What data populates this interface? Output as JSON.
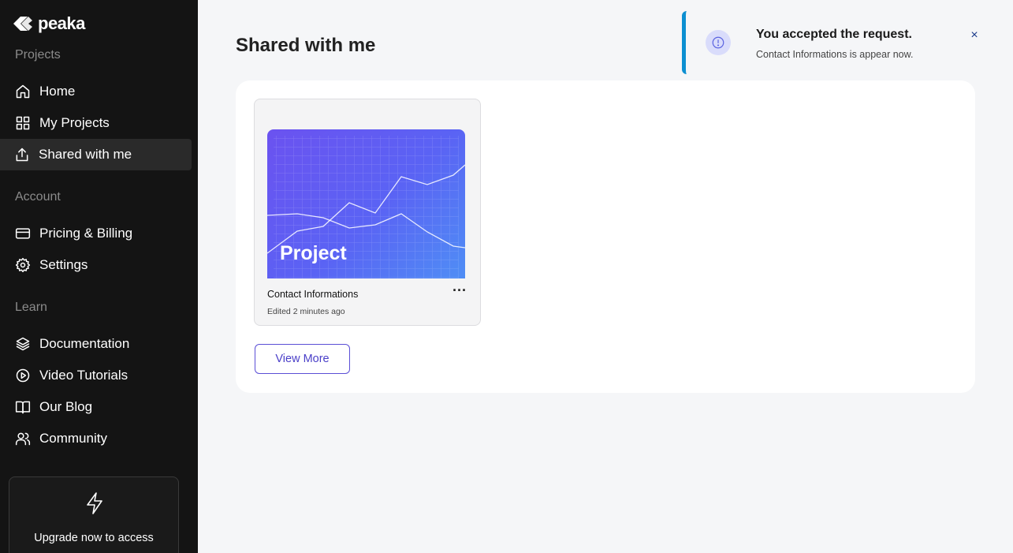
{
  "brand": {
    "name": "peaka"
  },
  "sidebar": {
    "sections": [
      {
        "label": "Projects"
      },
      {
        "label": "Account"
      },
      {
        "label": "Learn"
      }
    ],
    "items": [
      {
        "label": "Home",
        "icon": "home-icon"
      },
      {
        "label": "My Projects",
        "icon": "grid-icon"
      },
      {
        "label": "Shared with me",
        "icon": "share-icon",
        "active": true
      },
      {
        "label": "Pricing & Billing",
        "icon": "credit-card-icon"
      },
      {
        "label": "Settings",
        "icon": "gear-icon"
      },
      {
        "label": "Documentation",
        "icon": "layers-icon"
      },
      {
        "label": "Video Tutorials",
        "icon": "play-circle-icon"
      },
      {
        "label": "Our Blog",
        "icon": "book-icon"
      },
      {
        "label": "Community",
        "icon": "users-icon"
      }
    ],
    "upgrade": {
      "text": "Upgrade now to access",
      "icon": "bolt-icon"
    }
  },
  "main": {
    "title": "Shared with me",
    "projects": [
      {
        "thumb_label": "Project",
        "name": "Contact Informations",
        "edited": "Edited 2 minutes ago"
      }
    ],
    "view_more_label": "View More"
  },
  "toast": {
    "title": "You accepted the request.",
    "message": "Contact Informations is appear now.",
    "close_symbol": "×",
    "accent": "#0c8fd1",
    "icon": "info-circle-icon"
  },
  "colors": {
    "sidebar_bg": "#141414",
    "accent": "#5b4fd6"
  }
}
